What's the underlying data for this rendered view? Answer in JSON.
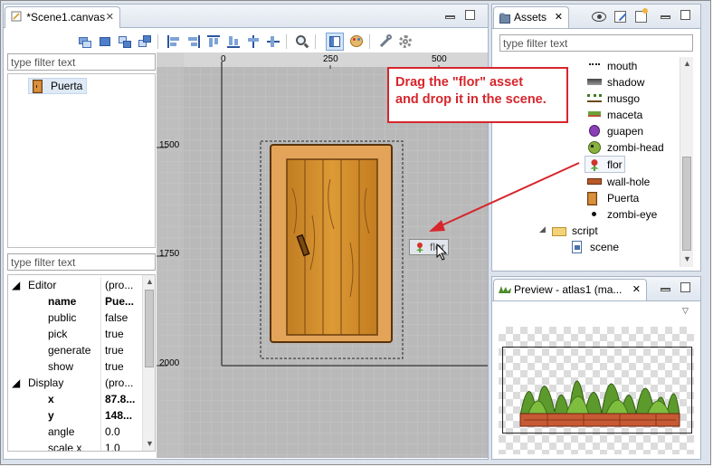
{
  "editor": {
    "tab_label": "*Scene1.canvas",
    "outline_filter_placeholder": "type filter text",
    "outline_items": [
      {
        "label": "Puerta",
        "icon": "door-icon"
      }
    ],
    "props_filter_placeholder": "type filter text",
    "properties": [
      {
        "key": "Editor",
        "value": "(pro...",
        "group": true,
        "bold": false
      },
      {
        "key": "name",
        "value": "Pue...",
        "group": false,
        "bold": true
      },
      {
        "key": "public",
        "value": "false",
        "group": false,
        "bold": false
      },
      {
        "key": "pick",
        "value": "true",
        "group": false,
        "bold": false
      },
      {
        "key": "generate",
        "value": "true",
        "group": false,
        "bold": false
      },
      {
        "key": "show",
        "value": "true",
        "group": false,
        "bold": false
      },
      {
        "key": "Display",
        "value": "(pro...",
        "group": true,
        "bold": false
      },
      {
        "key": "x",
        "value": "87.8...",
        "group": false,
        "bold": true
      },
      {
        "key": "y",
        "value": "148...",
        "group": false,
        "bold": true
      },
      {
        "key": "angle",
        "value": "0.0",
        "group": false,
        "bold": false
      },
      {
        "key": "scale x",
        "value": "1.0",
        "group": false,
        "bold": false
      }
    ]
  },
  "canvas": {
    "ruler_x": [
      "0",
      "250",
      "500"
    ],
    "ruler_y": [
      "1500",
      "1750",
      "2000"
    ],
    "drag_label": "flor"
  },
  "callout": {
    "line1": "Drag the \"flor\" asset",
    "line2": "and drop it in the scene."
  },
  "assets_panel": {
    "tab_label": "Assets",
    "filter_placeholder": "type filter text",
    "items": [
      {
        "label": "mouth",
        "icon": "mouth-icon",
        "selected": false
      },
      {
        "label": "shadow",
        "icon": "shadow-icon",
        "selected": false
      },
      {
        "label": "musgo",
        "icon": "musgo-icon",
        "selected": false
      },
      {
        "label": "maceta",
        "icon": "maceta-icon",
        "selected": false
      },
      {
        "label": "guapen",
        "icon": "guapen-icon",
        "selected": false
      },
      {
        "label": "zombi-head",
        "icon": "zombi-head-icon",
        "selected": false
      },
      {
        "label": "flor",
        "icon": "flower-icon",
        "selected": true
      },
      {
        "label": "wall-hole",
        "icon": "wall-hole-icon",
        "selected": false
      },
      {
        "label": "Puerta",
        "icon": "door-icon",
        "selected": false
      },
      {
        "label": "zombi-eye",
        "icon": "zombi-eye-icon",
        "selected": false
      }
    ],
    "folder_label": "script",
    "file_label": "scene"
  },
  "preview_panel": {
    "tab_label": "Preview - atlas1 (ma..."
  },
  "colors": {
    "accent": "#d6262c",
    "selection": "#dfeaf6",
    "canvas_bg": "#b9b9b9"
  }
}
